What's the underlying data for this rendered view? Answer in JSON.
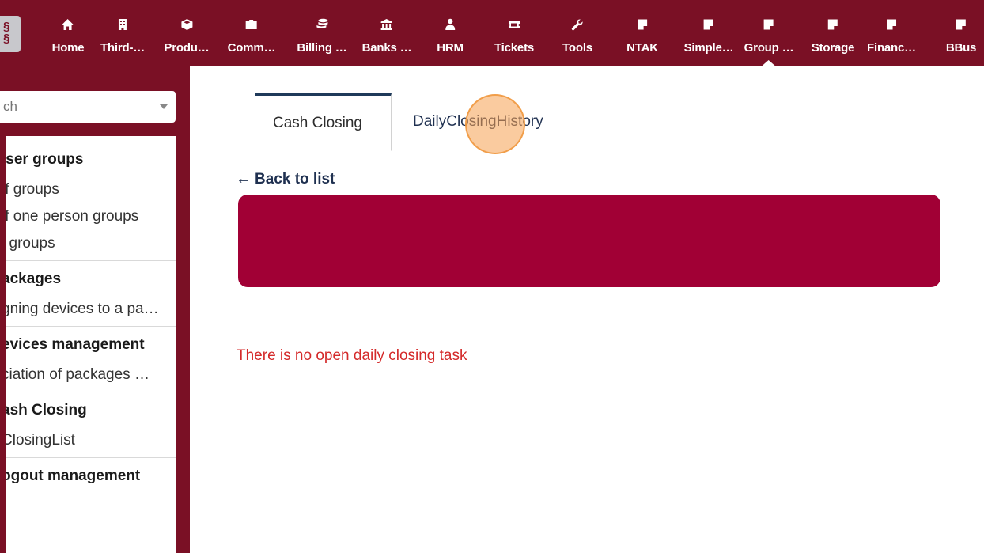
{
  "topnav": {
    "items": [
      {
        "label": "Home",
        "icon": "home-icon"
      },
      {
        "label": "Third-…",
        "icon": "building-icon"
      },
      {
        "label": "Produ…",
        "icon": "box-icon"
      },
      {
        "label": "Comm…",
        "icon": "briefcase-icon"
      },
      {
        "label": "Billing …",
        "icon": "coins-icon"
      },
      {
        "label": "Banks …",
        "icon": "bank-icon"
      },
      {
        "label": "HRM",
        "icon": "user-tie-icon"
      },
      {
        "label": "Tickets",
        "icon": "ticket-icon"
      },
      {
        "label": "Tools",
        "icon": "wrench-icon"
      },
      {
        "label": "NTAK",
        "icon": "note-icon"
      },
      {
        "label": "Simple…",
        "icon": "note-icon"
      },
      {
        "label": "Group …",
        "icon": "note-icon",
        "active": true
      },
      {
        "label": "Storage",
        "icon": "note-icon"
      },
      {
        "label": "Financ…",
        "icon": "note-icon"
      },
      {
        "label": "BBus",
        "icon": "note-icon"
      }
    ]
  },
  "sidebar": {
    "search_placeholder": "ch",
    "sections": [
      {
        "heading": "Iser groups",
        "links": [
          "if groups",
          "if one person groups",
          "l groups"
        ]
      },
      {
        "heading": "ackages",
        "links": [
          "gning devices to a pa…"
        ]
      },
      {
        "heading": "evices management",
        "links": [
          "ciation of packages …"
        ]
      },
      {
        "heading": "ash Closing",
        "links": [
          "ClosingList"
        ]
      },
      {
        "heading": "ogout management",
        "links": []
      }
    ]
  },
  "main": {
    "tabs": [
      {
        "label": "Cash Closing",
        "active": true
      },
      {
        "label": "DailyClosingHistory",
        "active": false
      }
    ],
    "back_label": "Back to list",
    "empty_message": "There is no open daily closing task"
  },
  "colors": {
    "brand": "#7a1025",
    "banner": "#a10035",
    "error_text": "#d42a2a",
    "link": "#1f3050"
  }
}
